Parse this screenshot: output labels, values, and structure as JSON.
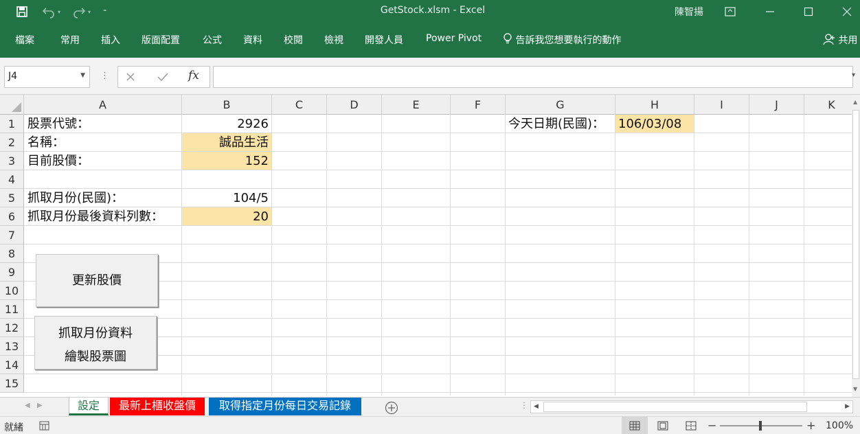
{
  "title_bar": {
    "title": "GetStock.xlsm  -  Excel",
    "user": "陳智揚"
  },
  "ribbon": {
    "tabs": [
      "檔案",
      "常用",
      "插入",
      "版面配置",
      "公式",
      "資料",
      "校閱",
      "檢視",
      "開發人員",
      "Power Pivot"
    ],
    "tell_me": "告訴我您想要執行的動作",
    "share": "共用"
  },
  "formula_bar": {
    "name_box": "J4",
    "fx": "fx",
    "formula": ""
  },
  "columns": [
    "A",
    "B",
    "C",
    "D",
    "E",
    "F",
    "G",
    "H",
    "I",
    "J",
    "K"
  ],
  "rows": [
    "1",
    "2",
    "3",
    "4",
    "5",
    "6",
    "7",
    "8",
    "9",
    "10",
    "11",
    "12",
    "13",
    "14",
    "15"
  ],
  "cells": {
    "a1": "股票代號：",
    "b1": "2926",
    "a2": "名稱：",
    "b2": "誠品生活",
    "a3": "目前股價：",
    "b3": "152",
    "a5": "抓取月份(民國)：",
    "b5": "104/5",
    "a6": "抓取月份最後資料列數：",
    "b6": "20",
    "g1": "今天日期(民國)：",
    "h1": "106/03/08"
  },
  "buttons": {
    "update_price": "更新股價",
    "fetch_line1": "抓取月份資料",
    "fetch_line2": "繪製股票圖"
  },
  "sheets": [
    {
      "label": "設定",
      "color": "#ffffff",
      "text_color": "#217346",
      "active": true
    },
    {
      "label": "最新上櫃收盤價",
      "color": "#ff0000",
      "text_color": "#ffffff"
    },
    {
      "label": "取得指定月份每日交易記錄",
      "color": "#0070c0",
      "text_color": "#ffffff"
    }
  ],
  "status": {
    "mode": "就緒",
    "zoom": "100%"
  },
  "colors": {
    "brand": "#217346",
    "cell_fill": "#fce4a6"
  }
}
